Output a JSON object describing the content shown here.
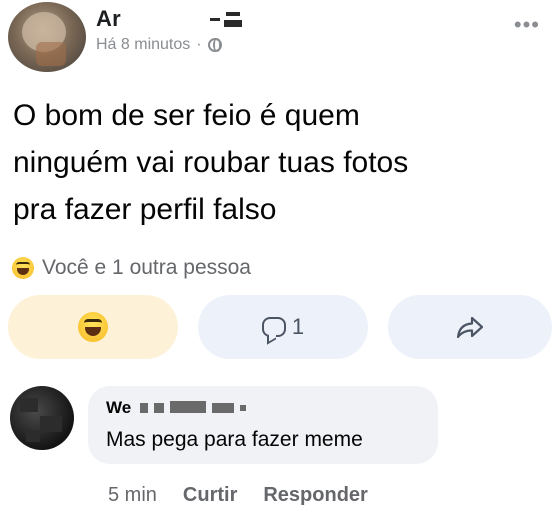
{
  "post": {
    "author": "Ar",
    "time": "Há 8 minutos",
    "separator": "·",
    "audience_icon": "globe-icon",
    "more_icon": "more-icon",
    "text": "O bom de ser feio é quem\nninguém vai roubar tuas fotos\npra fazer perfil falso"
  },
  "reactions": {
    "icon": "haha-icon",
    "summary": "Você e 1 outra pessoa"
  },
  "actions": {
    "react_icon": "haha-icon",
    "comment_icon": "comment-icon",
    "comment_count": "1",
    "share_icon": "share-icon"
  },
  "comment": {
    "author": "We",
    "text": "Mas pega para fazer meme",
    "time": "5 min",
    "like_label": "Curtir",
    "reply_label": "Responder"
  },
  "colors": {
    "text": "#050505",
    "muted": "#65676b",
    "react_bg": "#fdf1d8",
    "button_bg": "#edf1fa",
    "bubble_bg": "#f0f2f5"
  }
}
